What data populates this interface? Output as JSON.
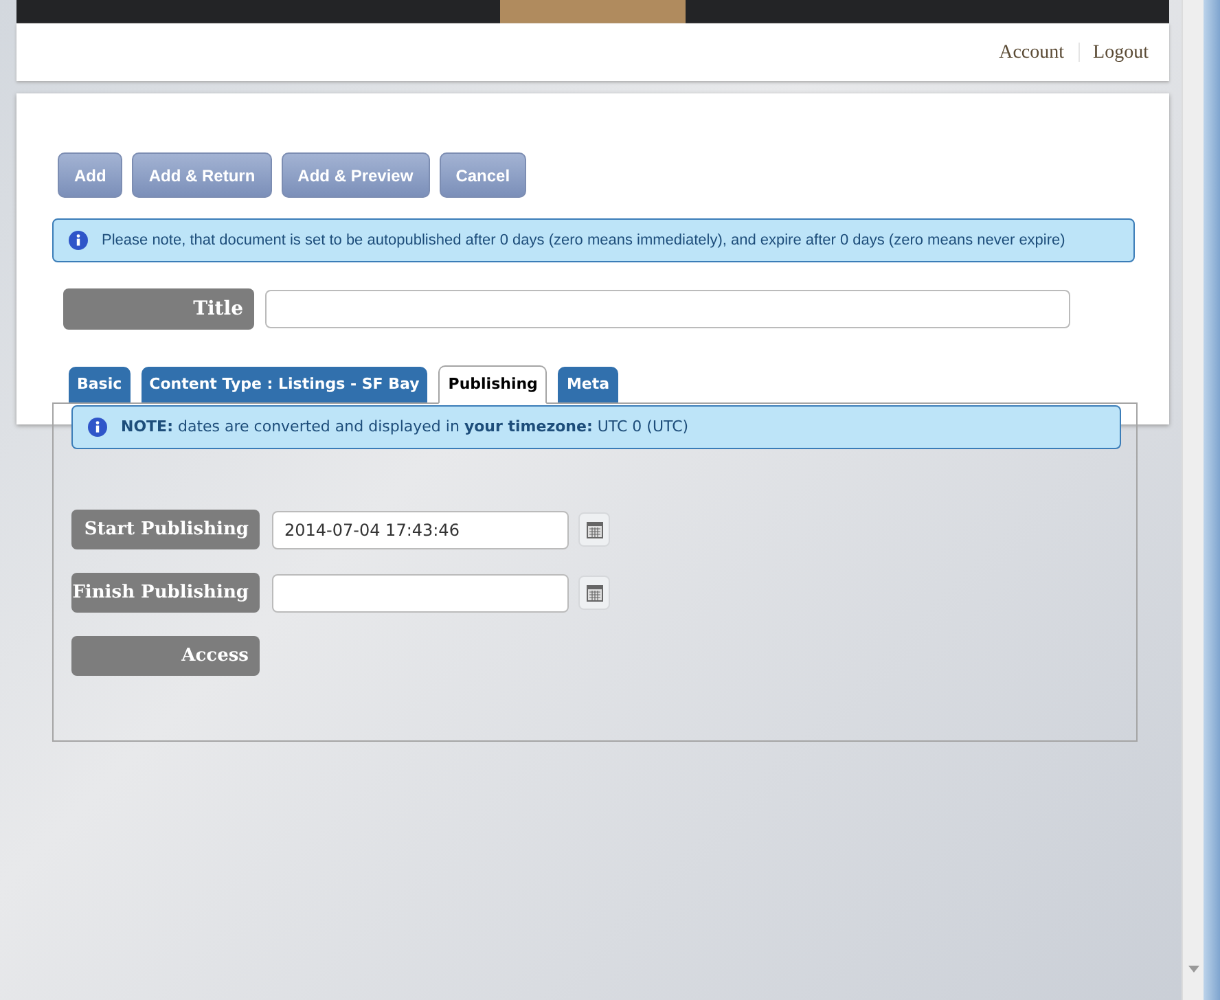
{
  "header": {
    "links": [
      "Account",
      "Logout"
    ]
  },
  "buttons": [
    "Add",
    "Add & Return",
    "Add & Preview",
    "Cancel"
  ],
  "info_message": "Please note, that document is set to be autopublished after 0 days (zero means immediately), and expire after 0 days (zero means never expire)",
  "title_field": {
    "label": "Title"
  },
  "tabs": [
    {
      "label": "Basic",
      "selected": false
    },
    {
      "label": "Content Type : Listings - SF Bay",
      "selected": false
    },
    {
      "label": "Publishing",
      "selected": true
    },
    {
      "label": "Meta",
      "selected": false
    }
  ],
  "note": "**NOTE:** dates are converted and displayed in **your timezone:** UTC 0 (UTC)",
  "fields": [
    {
      "kind": "date",
      "label": "Start Publishing",
      "value": "2014-07-04 17:43:46"
    },
    {
      "kind": "date",
      "label": "Finish Publishing"
    },
    {
      "kind": "label",
      "label": "Access"
    }
  ]
}
